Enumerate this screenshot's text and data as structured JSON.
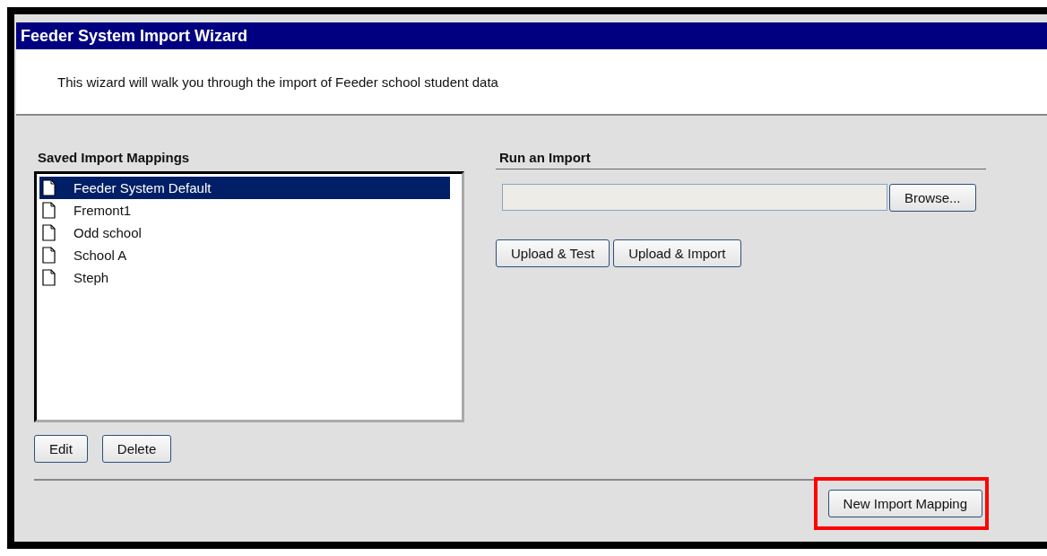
{
  "window": {
    "title": "Feeder System Import Wizard"
  },
  "intro": "This wizard will walk you through the import of Feeder school student data",
  "mappings": {
    "heading": "Saved Import Mappings",
    "items": [
      {
        "label": "Feeder System Default",
        "selected": true
      },
      {
        "label": "Fremont1",
        "selected": false
      },
      {
        "label": "Odd school",
        "selected": false
      },
      {
        "label": "School A",
        "selected": false
      },
      {
        "label": "Steph",
        "selected": false
      }
    ],
    "buttons": [
      "Edit",
      "Delete"
    ]
  },
  "run_import": {
    "heading": "Run an Import",
    "browse": "Browse...",
    "buttons": [
      "Upload & Test",
      "Upload & Import"
    ]
  },
  "footer_button": {
    "label": "New Import Mapping",
    "highlighted": true
  }
}
